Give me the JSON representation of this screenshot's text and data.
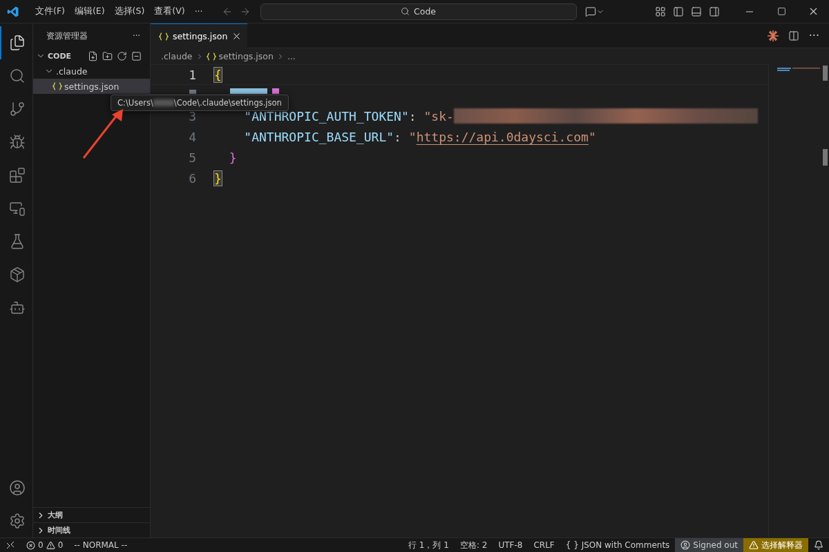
{
  "menu": [
    "文件(F)",
    "编辑(E)",
    "选择(S)",
    "查看(V)",
    "···"
  ],
  "command_center": {
    "value": "Code"
  },
  "activity_bar": [
    {
      "kind": "files",
      "selected": true
    },
    {
      "kind": "search",
      "selected": false
    },
    {
      "kind": "branch",
      "selected": false
    },
    {
      "kind": "debug",
      "selected": false
    },
    {
      "kind": "extensions",
      "selected": false
    },
    {
      "kind": "remote",
      "selected": false
    },
    {
      "kind": "flask",
      "selected": false
    },
    {
      "kind": "package",
      "selected": false
    },
    {
      "kind": "bot",
      "selected": false
    }
  ],
  "sidebar": {
    "title": "资源管理器",
    "more": "···",
    "folder": "CODE",
    "tree": [
      {
        "label": ".claude",
        "expanded": true,
        "selected": false,
        "children": [
          {
            "label": "settings.json",
            "selected": true
          }
        ]
      }
    ],
    "panels": [
      {
        "label": "大纲",
        "expanded": false
      },
      {
        "label": "时间线",
        "expanded": false
      }
    ]
  },
  "tooltip": {
    "path_start": "C:\\Users\\",
    "path_end": "\\Code\\.claude\\settings.json"
  },
  "tabs": [
    {
      "label": "settings.json",
      "selected": true
    }
  ],
  "breadcrumb": [
    ".claude",
    "settings.json",
    "..."
  ],
  "editor": {
    "lines": [
      {
        "number": "1",
        "current": true,
        "tokens": [
          {
            "kind": "match",
            "text": "{"
          }
        ]
      },
      {
        "kind": "covered"
      },
      {
        "number": "3",
        "current": false,
        "tokens": [
          {
            "kind": "key",
            "text": "    \"ANTHROPIC_AUTH_TOKEN\""
          },
          {
            "kind": "punct",
            "text": ": "
          },
          {
            "kind": "string",
            "text": "\"sk-"
          },
          {
            "kind": "redacted"
          }
        ]
      },
      {
        "number": "4",
        "current": false,
        "tokens": [
          {
            "kind": "key",
            "text": "    \"ANTHROPIC_BASE_URL\""
          },
          {
            "kind": "punct",
            "text": ": "
          },
          {
            "kind": "string",
            "text": "\""
          },
          {
            "kind": "link",
            "text": "https://api.0daysci.com"
          },
          {
            "kind": "string",
            "text": "\""
          }
        ]
      },
      {
        "number": "5",
        "current": false,
        "tokens": [
          {
            "kind": "brace2",
            "text": "  }"
          }
        ]
      },
      {
        "number": "6",
        "current": false,
        "tokens": [
          {
            "kind": "match",
            "text": "}"
          }
        ]
      }
    ]
  },
  "status_bar": {
    "errors": "0",
    "warnings": "0",
    "mode": "-- NORMAL --",
    "position": "行 1，列 1",
    "spaces": "空格: 2",
    "encoding": "UTF-8",
    "eol": "CRLF",
    "language": "{ } JSON with Comments",
    "account": "Signed out",
    "interpreter": "选择解释器"
  }
}
